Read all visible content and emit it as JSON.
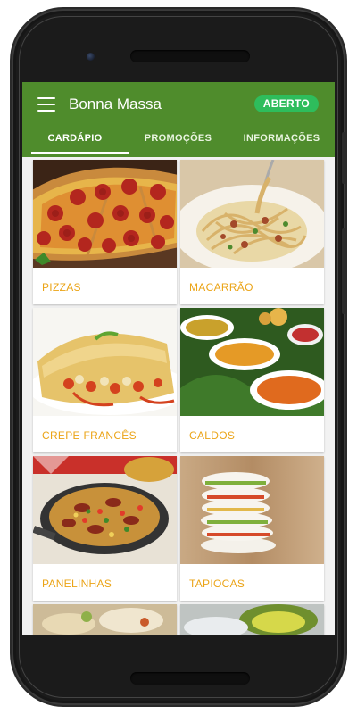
{
  "app": {
    "title": "Bonna Massa",
    "status": "ABERTO"
  },
  "tabs": [
    {
      "label": "CARDÁPIO",
      "active": true
    },
    {
      "label": "PROMOÇÕES",
      "active": false
    },
    {
      "label": "INFORMAÇÕES",
      "active": false
    }
  ],
  "menu": {
    "items": [
      {
        "label": "PIZZAS"
      },
      {
        "label": "MACARRÃO"
      },
      {
        "label": "CREPE FRANCÊS"
      },
      {
        "label": "CALDOS"
      },
      {
        "label": "PANELINHAS"
      },
      {
        "label": "TAPIOCAS"
      }
    ]
  },
  "colors": {
    "appbar": "#4f8c2c",
    "badge": "#2ebd5c",
    "label": "#eba417"
  },
  "icons": {
    "menu": "hamburger-menu-icon"
  }
}
